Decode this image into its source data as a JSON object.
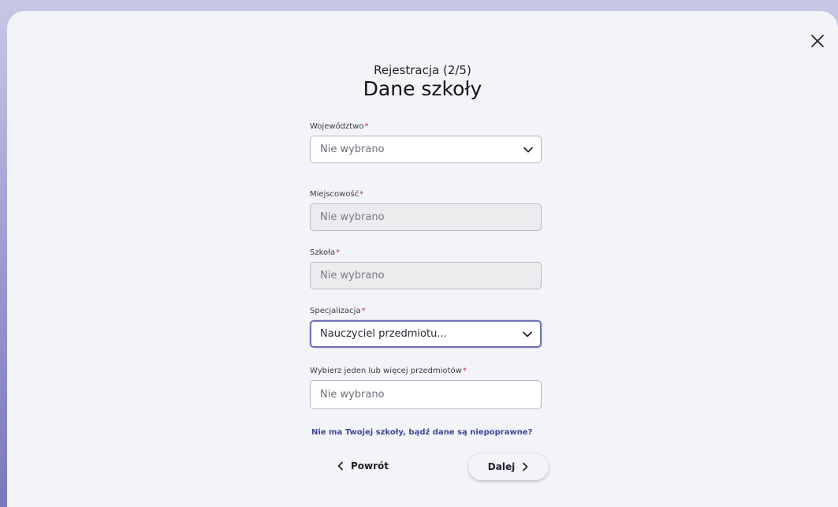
{
  "header": {
    "step": "Rejestracja (2/5)",
    "title": "Dane szkoły"
  },
  "form": {
    "required_mark": "*",
    "fields": [
      {
        "label": "Województwo",
        "value": "Nie wybrano",
        "type": "select",
        "state": "enabled"
      },
      {
        "label": "Miejscowość",
        "value": "Nie wybrano",
        "type": "input",
        "state": "disabled"
      },
      {
        "label": "Szkoła",
        "value": "Nie wybrano",
        "type": "input",
        "state": "disabled"
      },
      {
        "label": "Specjalizacja",
        "value": "Nauczyciel przedmiotu...",
        "type": "select",
        "state": "focused"
      },
      {
        "label": "Wybierz jeden lub więcej przedmiotów",
        "value": "Nie wybrano",
        "type": "input",
        "state": "enabled"
      }
    ]
  },
  "links": {
    "missing_school": "Nie ma Twojej szkoły, bądź dane są niepoprawne?"
  },
  "buttons": {
    "back": "Powrót",
    "next": "Dalej"
  },
  "icons": {
    "close": "close-icon",
    "dropdown": "chevron-down-icon",
    "back": "chevron-left-icon",
    "next": "chevron-right-icon"
  },
  "colors": {
    "required": "#d3294b",
    "link": "#3f4697",
    "focus_border": "#6e73b8",
    "modal_bg": "#f3f4f8"
  }
}
